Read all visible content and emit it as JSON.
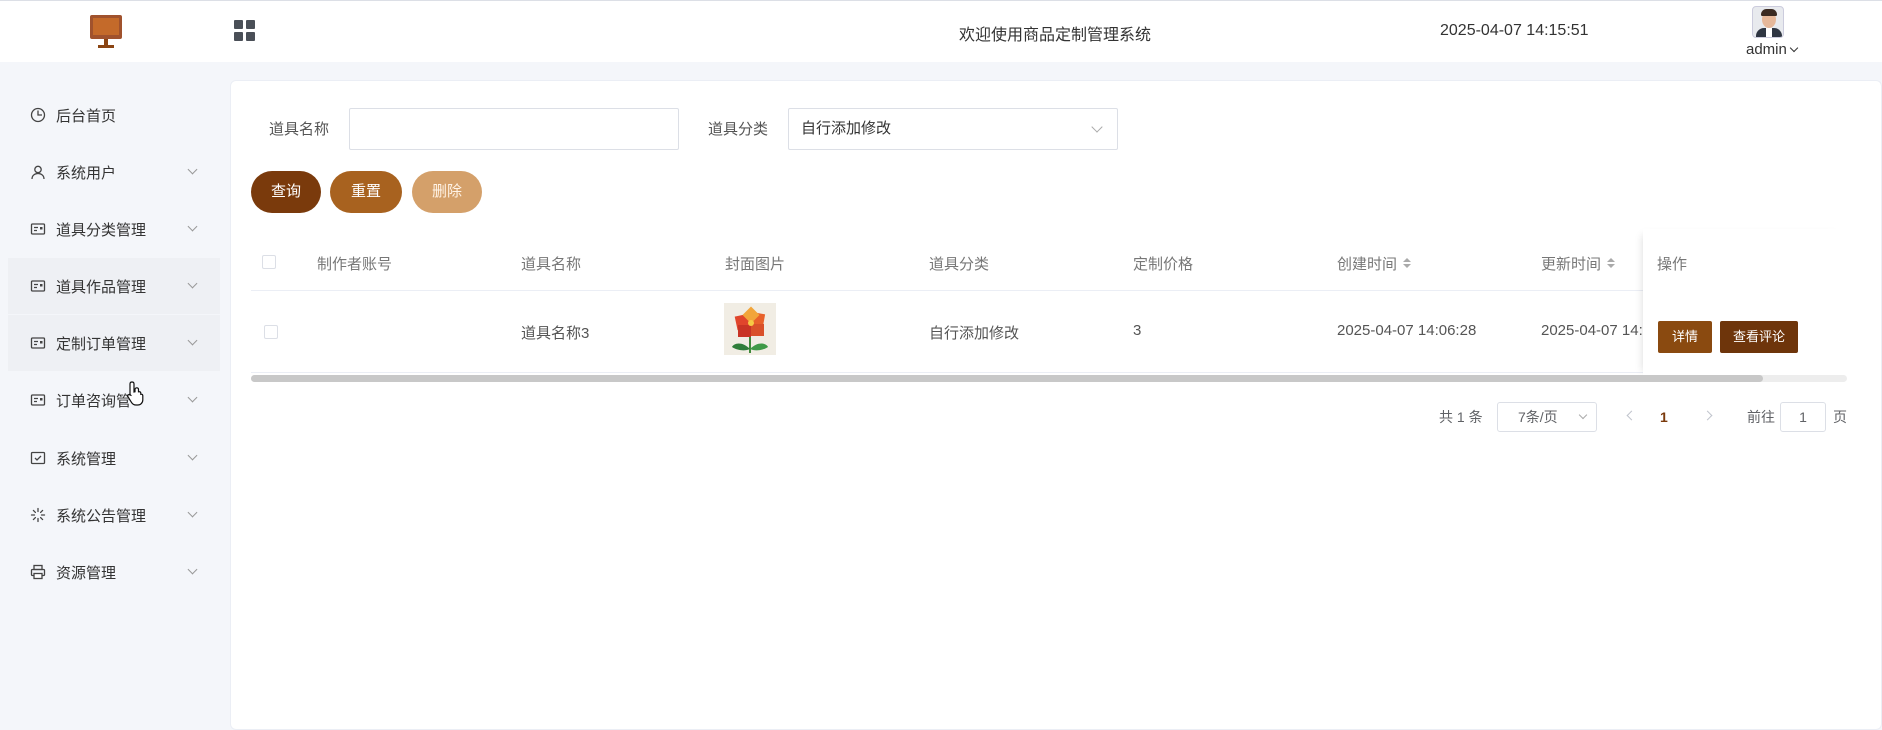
{
  "header": {
    "title": "欢迎使用商品定制管理系统",
    "datetime": "2025-04-07 14:15:51",
    "user": "admin"
  },
  "sidebar": {
    "items": [
      {
        "label": "后台首页",
        "icon": "clock-icon",
        "has_children": false
      },
      {
        "label": "系统用户",
        "icon": "user-icon",
        "has_children": true
      },
      {
        "label": "道具分类管理",
        "icon": "card-icon",
        "has_children": true
      },
      {
        "label": "道具作品管理",
        "icon": "card-icon",
        "has_children": true
      },
      {
        "label": "定制订单管理",
        "icon": "card-icon",
        "has_children": true
      },
      {
        "label": "订单咨询管",
        "icon": "card-icon",
        "has_children": true
      },
      {
        "label": "系统管理",
        "icon": "check-box-icon",
        "has_children": true
      },
      {
        "label": "系统公告管理",
        "icon": "loading-icon",
        "has_children": true
      },
      {
        "label": "资源管理",
        "icon": "printer-icon",
        "has_children": true
      }
    ]
  },
  "search": {
    "name_label": "道具名称",
    "name_value": "",
    "category_label": "道具分类",
    "category_value": "自行添加修改"
  },
  "buttons": {
    "query": "查询",
    "reset": "重置",
    "delete": "删除"
  },
  "table": {
    "columns": [
      "制作者账号",
      "道具名称",
      "封面图片",
      "道具分类",
      "定制价格",
      "创建时间",
      "更新时间",
      "操作"
    ],
    "rows": [
      {
        "maker_account": "",
        "name": "道具名称3",
        "category": "自行添加修改",
        "price": "3",
        "created": "2025-04-07 14:06:28",
        "updated": "2025-04-07 14:1",
        "actions": [
          "详情",
          "查看评论"
        ]
      }
    ]
  },
  "pagination": {
    "total": "共 1 条",
    "page_size": "7条/页",
    "current": "1",
    "goto_label": "前往",
    "goto_value": "1",
    "page_suffix": "页"
  },
  "colors": {
    "primary": "#7a3a0c",
    "secondary": "#a8621f",
    "light": "#d4a06a"
  }
}
